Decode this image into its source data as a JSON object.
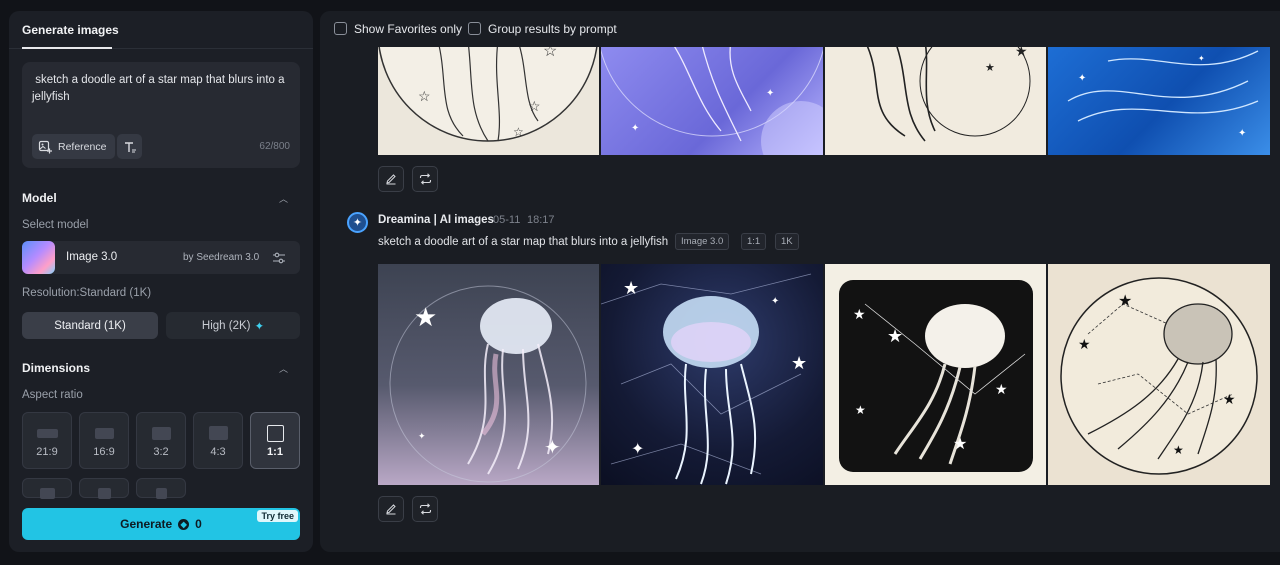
{
  "sidebar": {
    "tab_label": "Generate images",
    "prompt": {
      "text": " sketch a doodle art of a star map that blurs into a jellyfish",
      "reference_label": "Reference",
      "char_count": "62/800"
    },
    "model": {
      "section_title": "Model",
      "select_label": "Select model",
      "name": "Image 3.0",
      "provider": "by Seedream 3.0",
      "resolution_label": "Resolution:Standard (1K)",
      "resolution_options": [
        "Standard (1K)",
        "High (2K)"
      ],
      "resolution_selected": "Standard (1K)"
    },
    "dimensions": {
      "section_title": "Dimensions",
      "aspect_label": "Aspect ratio",
      "ratios": [
        "21:9",
        "16:9",
        "3:2",
        "4:3",
        "1:1"
      ],
      "selected_ratio": "1:1"
    },
    "generate": {
      "label": "Generate",
      "cost": "0",
      "badge": "Try free"
    }
  },
  "main": {
    "filters": {
      "favorites_label": "Show Favorites only",
      "group_label": "Group results by prompt"
    },
    "result": {
      "author": "Dreamina | AI images",
      "date": "05-11",
      "time": "18:17",
      "prompt": "sketch a doodle art of a star map that blurs into a jellyfish",
      "model_chip": "Image 3.0",
      "ratio_chip": "1:1",
      "res_chip": "1K"
    }
  },
  "colors": {
    "accent": "#22c4e4",
    "panel": "#1c1f26",
    "background": "#111318"
  }
}
